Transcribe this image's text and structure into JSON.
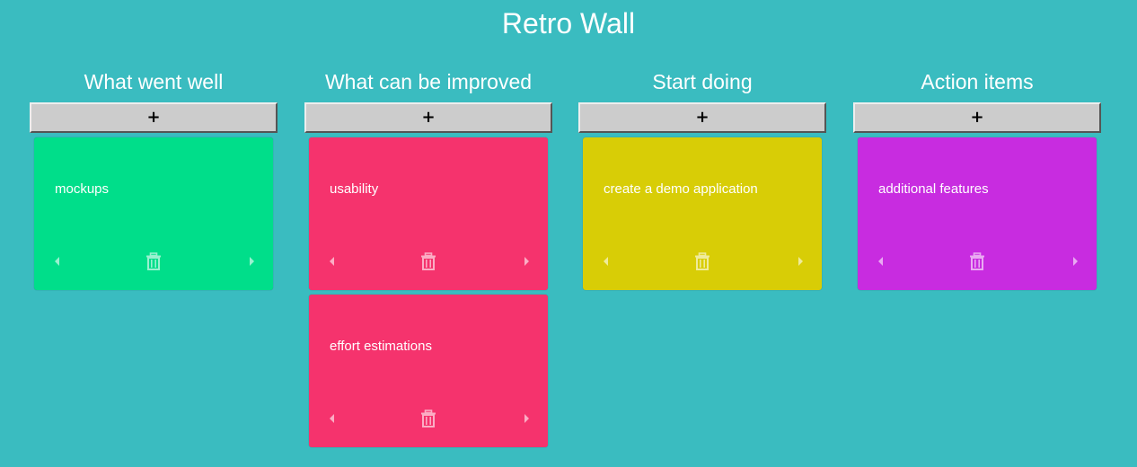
{
  "app": {
    "title": "Retro Wall"
  },
  "colors": {
    "background": "#3abcc0",
    "add_button": "#cccccc",
    "went_well": "#00de8a",
    "improve": "#f5336d",
    "start_doing": "#d8cd06",
    "action_items": "#c82ce0"
  },
  "columns": [
    {
      "title": "What went well",
      "add_label": "+",
      "color": "#00de8a",
      "cards": [
        {
          "text": "mockups"
        }
      ]
    },
    {
      "title": "What can be improved",
      "add_label": "+",
      "color": "#f5336d",
      "cards": [
        {
          "text": "usability"
        },
        {
          "text": "effort estimations"
        }
      ]
    },
    {
      "title": "Start doing",
      "add_label": "+",
      "color": "#d8cd06",
      "cards": [
        {
          "text": "create a demo application"
        }
      ]
    },
    {
      "title": "Action items",
      "add_label": "+",
      "color": "#c82ce0",
      "cards": [
        {
          "text": "additional features"
        }
      ]
    }
  ],
  "icons": {
    "move_left": "caret-left-icon",
    "delete": "trash-icon",
    "move_right": "caret-right-icon"
  }
}
